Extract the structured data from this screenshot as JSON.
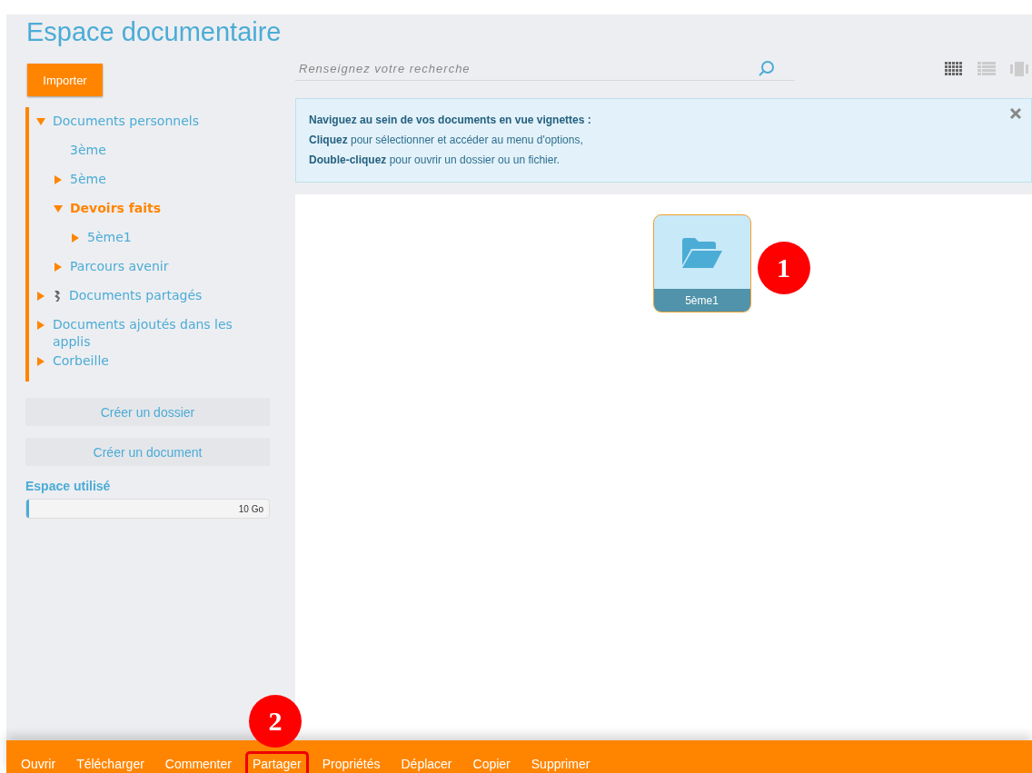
{
  "title": "Espace documentaire",
  "import_button": "Importer",
  "tree": [
    {
      "label": "Documents personnels",
      "expanded": true,
      "selected": false,
      "children": [
        {
          "label": "3ème",
          "selected": false
        },
        {
          "label": "5ème",
          "expanded": false,
          "selected": false
        },
        {
          "label": "Devoirs faits",
          "expanded": true,
          "selected": true,
          "children": [
            {
              "label": "5ème1",
              "expanded": false,
              "selected": false
            }
          ]
        },
        {
          "label": "Parcours avenir",
          "expanded": false,
          "selected": false
        }
      ]
    },
    {
      "label": "Documents partagés",
      "expanded": false,
      "selected": false,
      "kind": "shared"
    },
    {
      "label": "Documents ajoutés dans les applis",
      "expanded": false,
      "selected": false
    },
    {
      "label": "Corbeille",
      "expanded": false,
      "selected": false
    }
  ],
  "sidebar_buttons": [
    "Créer un dossier",
    "Créer un document"
  ],
  "storage": {
    "label": "Espace utilisé",
    "level": 0.01,
    "reading": "10 Go"
  },
  "search": {
    "placeholder": "Renseignez votre recherche"
  },
  "view_modes": [
    {
      "kind": "grid",
      "selected": true
    },
    {
      "kind": "list",
      "selected": false
    },
    {
      "kind": "carousel",
      "selected": false
    }
  ],
  "info": {
    "lines": [
      "**Naviguez au sein de vos documents en vue vignettes :**",
      "**Cliquez** pour sélectionner et accéder au menu d'options,",
      "**Double-cliquez** pour ouvrir un dossier ou un fichier."
    ]
  },
  "items": [
    {
      "name": "5ème1",
      "selected": true,
      "annotation": "1"
    }
  ],
  "actions": [
    {
      "label": "Ouvrir",
      "highlighted": false
    },
    {
      "label": "Télécharger",
      "highlighted": false
    },
    {
      "label": "Commenter",
      "highlighted": false
    },
    {
      "label": "Partager",
      "highlighted": true,
      "annotation": "2"
    },
    {
      "label": "Propriétés",
      "highlighted": false
    },
    {
      "label": "Déplacer",
      "highlighted": false
    },
    {
      "label": "Copier",
      "highlighted": false
    },
    {
      "label": "Supprimer",
      "highlighted": false
    }
  ]
}
